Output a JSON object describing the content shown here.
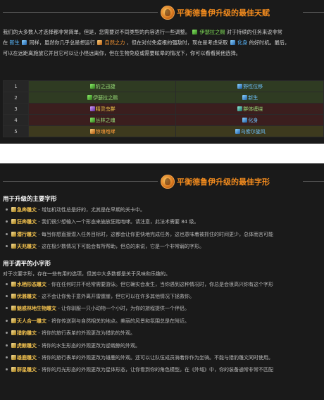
{
  "talents_section": {
    "title": "平衡德鲁伊升级的最佳天赋",
    "intro_parts": {
      "p1": "我们的大多数人才选择都非常简单。但是，您需要对不同类型的内容进行一些调整。",
      "p1_link": "伊瑟拉之赐",
      "p1_end": "对于持续的任务来说非常",
      "p2_start": "在 ",
      "p2_link1": "新生",
      "p2_mid": "同样，虽然你几乎总是想运行",
      "p2_link2": "自然之力",
      "p2_mid2": "，但在对付免疫根的强敌时，现在是考虑采取",
      "p2_link3": "化身",
      "p2_end": "的好时机。最后，",
      "p3": "可以在远距离施放它并且它可以让小怪远离你，但在生物免疫或需要眩晕的情况下，你可以看看其他选择。"
    },
    "table": [
      {
        "num": "1",
        "left": "豹之迅捷",
        "right": "野性位移"
      },
      {
        "num": "2",
        "left": "伊瑟拉之赐",
        "right": "新生"
      },
      {
        "num": "3",
        "left": "精灵虫群",
        "right": "群体缠绕"
      },
      {
        "num": "4",
        "left": "丛林之魂",
        "right": "化身"
      },
      {
        "num": "5",
        "left": "惊魂咆哮",
        "right": "乌索尔旋风"
      }
    ]
  },
  "glyphs_section": {
    "title": "平衡德鲁伊升级的最佳字形",
    "major_title": "用于升级的主要字形",
    "major": [
      {
        "name": "急奔雕文",
        "desc": " - 增加机动性总是好的，尤其是在早期的关卡中。"
      },
      {
        "name": "狂奔雕文",
        "desc": " - 我们很少想输入一个形态来施放狂踏咆哮。请注意，此法术需要 84 级。"
      },
      {
        "name": "潜行雕文",
        "desc": " - 每当你想直接潜入任务目标时，这都会让你更快地完成任务，这也意味着被抓住的时间更少，总体而言可能"
      },
      {
        "name": "天兆雕文",
        "desc": " - 这在极少数情况下可能会有所帮助，但总的来说，它是一个非常弱的字形。"
      }
    ],
    "minor_title": "用于调平的小字形",
    "minor_desc": "对于次要字形，存在一些有用的选项，但其中大多数都是关于风味和乐趣的。",
    "minor": [
      {
        "name": "水栖形态雕文",
        "desc": " - 你在任何时并不经常需要游泳。但它确实会发生，当你遇到这种情况时，你总是会很高兴你有这个字形"
      },
      {
        "name": "优雅雕文",
        "desc": " - 这不会让你免于意外离开雷霆崖，但它可以在许多其他情况下拯救你。"
      },
      {
        "name": "魅惑林地生物雕文",
        "desc": " - 让你驯服一只小动物一个小时，为你的旅程提供一个伴侣。"
      },
      {
        "name": "天人合一雕文",
        "desc": " - 将你传送到与自然相关的地点。美丽的风景和氛围总是在附近。"
      },
      {
        "name": "猎豹雕文",
        "desc": " - 将你的旅行表单的外观更改为猎豹的外观。"
      },
      {
        "name": "虎鲸雕文",
        "desc": " - 将你的水生形态的外观更改为逆戟鲸的外观。"
      },
      {
        "name": "雄鹿雕文",
        "desc": " - 将你的旅行表单的外观更改为雄鹿的外观。还可以让队伍成员骑着你作为坐骑。不能与猎豹雕文同时使用。"
      },
      {
        "name": "群星雕文",
        "desc": " - 将你的月光形态的外观更改为星体形态，让你看到你的角色模型。在《外域》中，你的装备通常非常不匹配"
      }
    ]
  }
}
